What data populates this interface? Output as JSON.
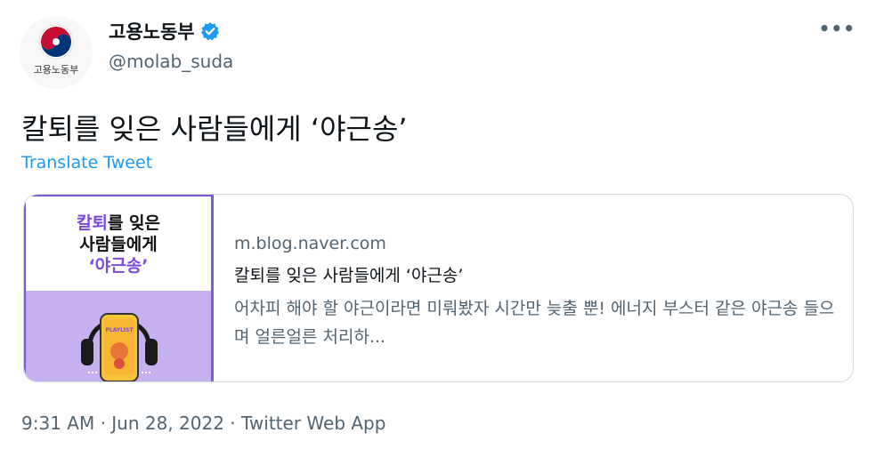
{
  "author": {
    "display_name": "고용노동부",
    "handle": "@molab_suda",
    "avatar_label": "고용노동부",
    "verified": true
  },
  "tweet": {
    "text": "칼퇴를 잊은 사람들에게 ‘야근송’",
    "translate_label": "Translate Tweet"
  },
  "card": {
    "thumbnail": {
      "line1_accent": "칼퇴",
      "line1_rest": "를 잊은",
      "line2": "사람들에게",
      "line3": "‘야근송’",
      "phone_label": "PLAYLIST"
    },
    "domain": "m.blog.naver.com",
    "title": "칼퇴를 잊은 사람들에게 ‘야근송’",
    "description": "어차피 해야 할 야근이라면 미뤄봤자 시간만 늦출 뿐! 에너지 부스터 같은 야근송 들으며 얼른얼른 처리하..."
  },
  "footer": {
    "timestamp": "9:31 AM · Jun 28, 2022 · Twitter Web App"
  },
  "icons": {
    "more": "more-icon",
    "verified": "verified-badge-icon"
  },
  "colors": {
    "link": "#1d9bf0",
    "secondary_text": "#536471",
    "accent_purple": "#7b48e0",
    "thumb_purple_bg": "#c6b0f0"
  }
}
